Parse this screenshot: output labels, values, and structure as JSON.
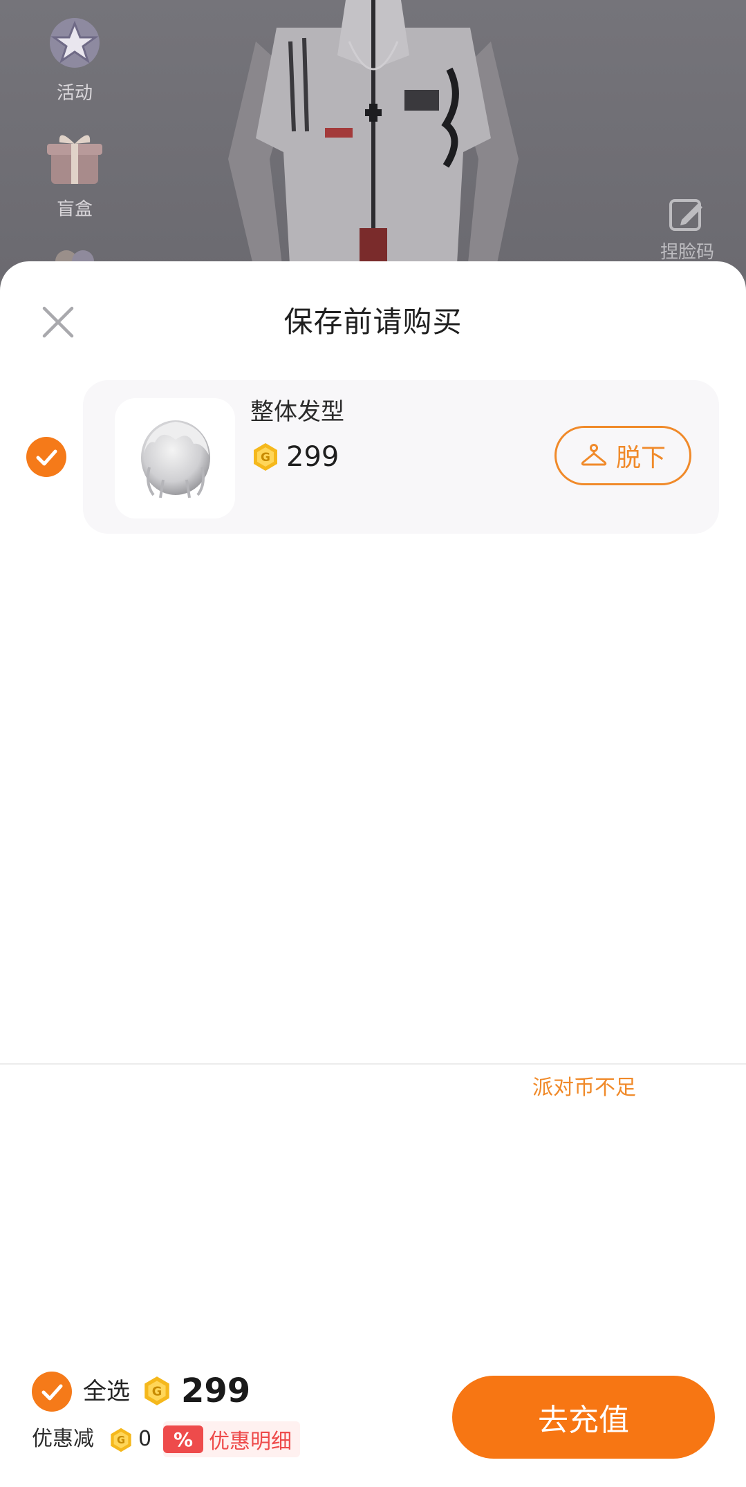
{
  "background": {
    "side_menu": [
      {
        "label": "活动",
        "icon": "star-badge-icon"
      },
      {
        "label": "盲盒",
        "icon": "gift-box-icon"
      }
    ],
    "face_clip_label": "捏脸码"
  },
  "sheet": {
    "title": "保存前请购买",
    "close_icon": "close-icon"
  },
  "items": [
    {
      "name": "整体发型",
      "price": "299",
      "checked": true,
      "thumbnail": "white-hair-thumbnail",
      "takeoff_label": "脱下"
    }
  ],
  "footer": {
    "insufficient_text": "派对币不足",
    "select_all_label": "全选",
    "total_price": "299",
    "discount_label": "优惠减",
    "discount_value": "0",
    "discount_tag": "%",
    "discount_detail_label": "优惠明细",
    "recharge_label": "去充值"
  },
  "colors": {
    "accent": "#f57a19",
    "discount_red": "#ee4b4b",
    "coin_gold": "#f5b81c",
    "overlay": "#6e6d72"
  }
}
